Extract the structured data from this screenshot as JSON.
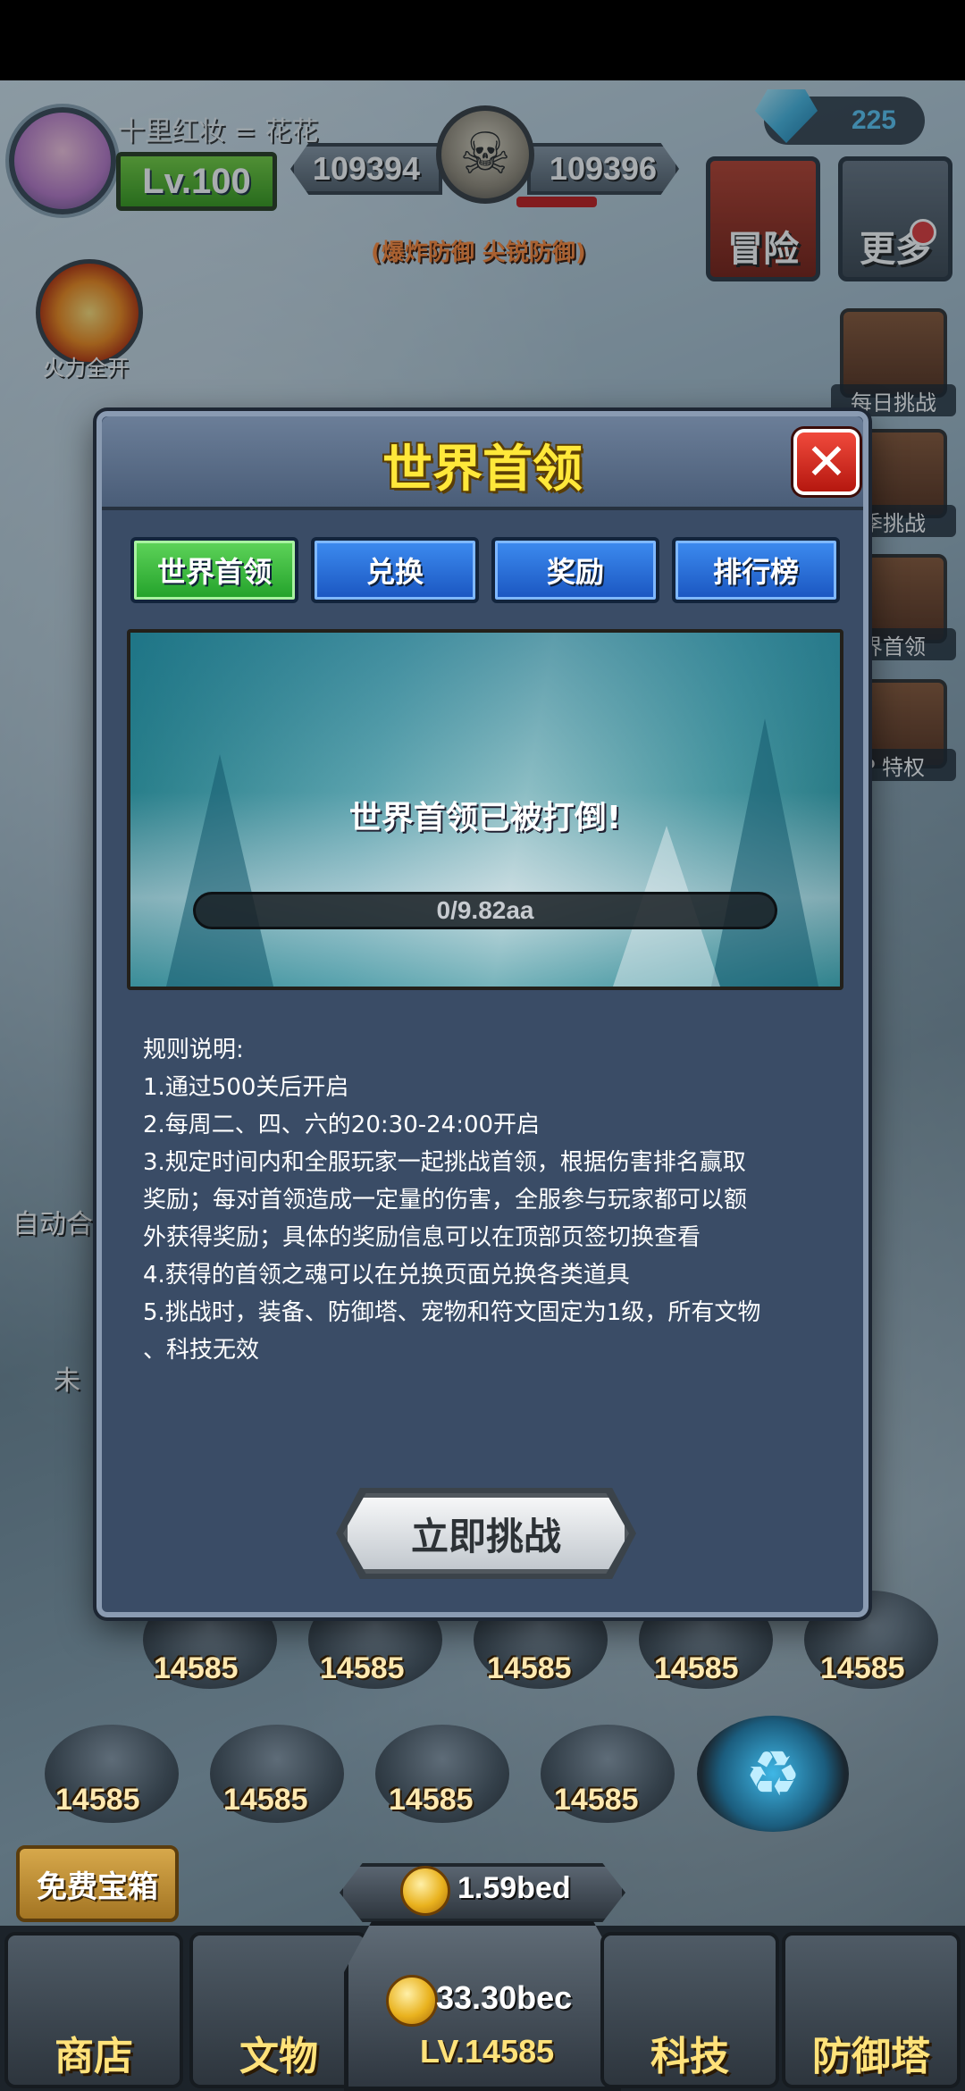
{
  "hud": {
    "player_name": "十里红妆 = 花花",
    "level": "Lv.100",
    "score_left": "109394",
    "score_right": "109396",
    "boss_traits": "(爆炸防御 尖锐防御)",
    "gems": "225",
    "adventure_label": "冒险",
    "more_label": "更多",
    "fire_label": "火力全开"
  },
  "side_menu": [
    {
      "label": "每日挑战"
    },
    {
      "label": "季挑战"
    },
    {
      "label": "界首领"
    },
    {
      "label": "P 特权"
    }
  ],
  "left_fragments": {
    "auto_merge": "自动合",
    "unlock": "未"
  },
  "dialog": {
    "title": "世界首领",
    "close_symbol": "✕",
    "tabs": [
      {
        "label": "世界首领",
        "active": true
      },
      {
        "label": "兑换",
        "active": false
      },
      {
        "label": "奖励",
        "active": false
      },
      {
        "label": "排行榜",
        "active": false
      }
    ],
    "status": "世界首领已被打倒!",
    "hp_text": "0/9.82aa",
    "hp_fraction": 0,
    "rules_title": "规则说明:",
    "rules": [
      "1.通过500关后开启",
      "2.每周二、四、六的20:30-24:00开启",
      "3.规定时间内和全服玩家一起挑战首领，根据伤害排名赢取",
      "奖励；每对首领造成一定量的伤害，全服参与玩家都可以额",
      "外获得奖励；具体的奖励信息可以在顶部页签切换查看",
      "4.获得的首领之魂可以在兑换页面兑换各类道具",
      "5.挑战时，装备、防御塔、宠物和符文固定为1级，所有文物",
      "、科技无效"
    ],
    "challenge_label": "立即挑战"
  },
  "towers": {
    "value": "14585"
  },
  "bottom": {
    "free_chest": "免费宝箱",
    "coins": "1.59bed",
    "center_coins": "33.30bec",
    "center_level": "LV.14585",
    "nav": [
      {
        "label": "商店"
      },
      {
        "label": "文物"
      },
      {
        "label": "科技"
      },
      {
        "label": "防御塔"
      }
    ]
  }
}
